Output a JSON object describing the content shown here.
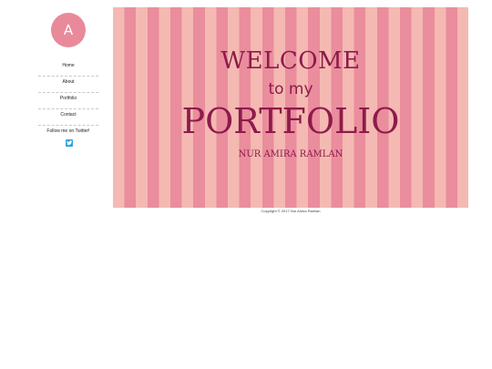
{
  "sidebar": {
    "logo_letter": "A",
    "nav": [
      "Home",
      "About",
      "Portfolio",
      "Contact"
    ],
    "follow_label": "Follow me on Twitter!",
    "twitter_icon": "twitter-bird-icon"
  },
  "banner": {
    "welcome": "WELCOME",
    "to_my": "to my",
    "title": "PORTFOLIO",
    "author": "NUR AMIRA RAMLAN"
  },
  "footer": {
    "copyright": "Copyright © 2017 Nur Amira Ramlan"
  },
  "colors": {
    "accent": "#e88a9a",
    "stripe_light": "#f4b9b2",
    "stripe_dark": "#ea8d9d",
    "title_text": "#8e1a4b",
    "twitter": "#2aa3e0"
  }
}
